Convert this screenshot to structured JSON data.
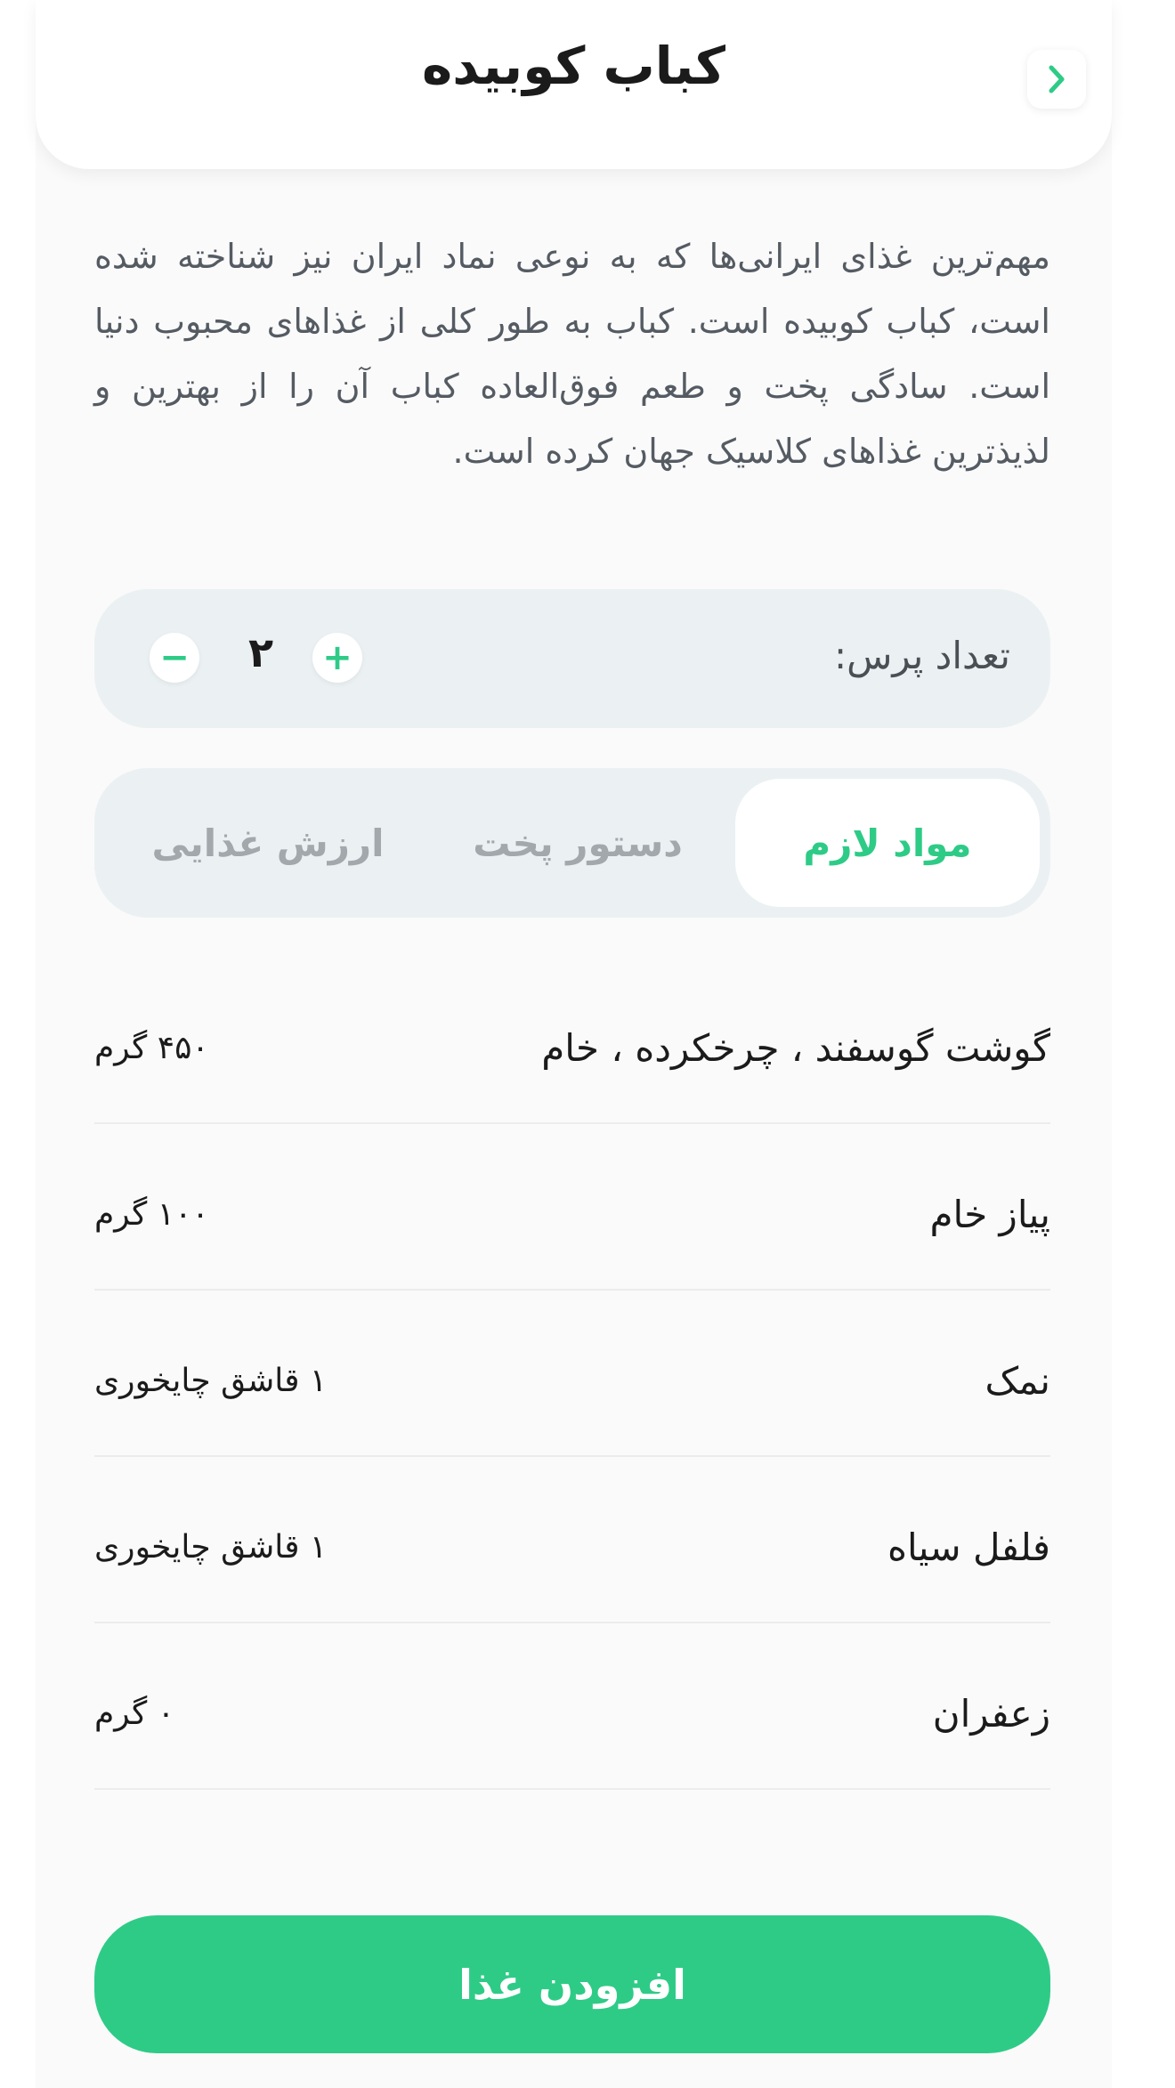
{
  "header": {
    "title": "کباب کوبیده",
    "back_icon": "chevron-icon"
  },
  "description": "مهم‌ترین غذای ایرانی‌ها که به نوعی نماد ایران نیز شناخته شده است، کباب کوبیده است. کباب به طور کلی از غذاهای محبوب دنیا است. سادگی پخت و طعم فوق‌العاده کباب آن را از بهترین و لذیذترین غذاهای کلاسیک جهان کرده است.",
  "serving": {
    "label": "تعداد پرس:",
    "value": "۲",
    "plus_label": "+",
    "minus_label": "−"
  },
  "tabs": [
    {
      "label": "مواد لازم",
      "active": true
    },
    {
      "label": "دستور پخت",
      "active": false
    },
    {
      "label": "ارزش غذایی",
      "active": false
    }
  ],
  "ingredients": [
    {
      "name": "گوشت گوسفند ، چرخکرده ، خام",
      "amount": "۴۵۰ گرم"
    },
    {
      "name": "پیاز خام",
      "amount": "۱۰۰ گرم"
    },
    {
      "name": "نمک",
      "amount": "۱ قاشق چایخوری"
    },
    {
      "name": "فلفل سیاه",
      "amount": "۱ قاشق چایخوری"
    },
    {
      "name": "زعفران",
      "amount": "۰ گرم"
    }
  ],
  "add_button": {
    "label": "افزودن غذا"
  },
  "colors": {
    "accent": "#2ecb87",
    "panel": "#ebf1f3",
    "text": "#1b1b1b",
    "muted": "#a3a8ad"
  }
}
